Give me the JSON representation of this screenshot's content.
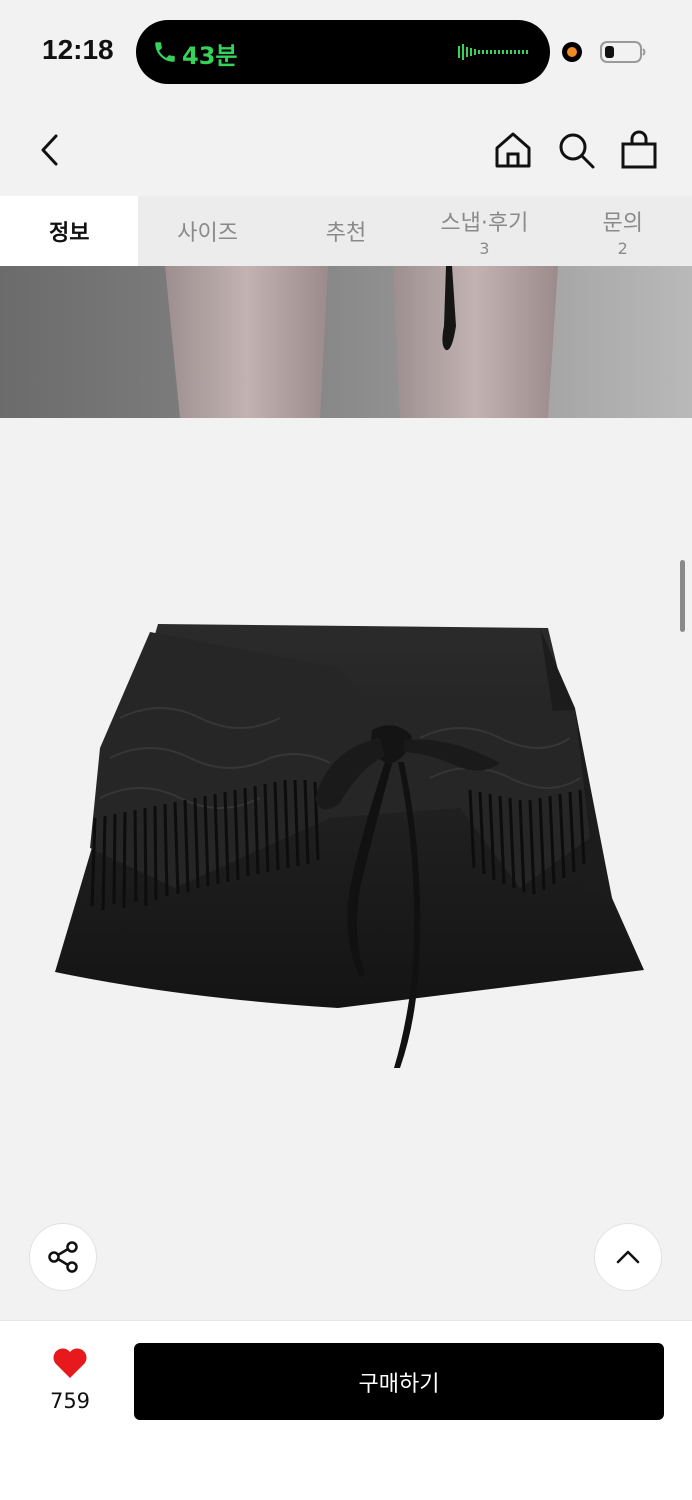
{
  "status_bar": {
    "time": "12:18",
    "call_duration": "43분",
    "accent_green": "#35d35a",
    "recording_color": "#f08a24"
  },
  "header": {
    "icons": [
      "back-icon",
      "home-icon",
      "search-icon",
      "bag-icon"
    ]
  },
  "tabs": [
    {
      "label": "정보",
      "count": "",
      "active": true
    },
    {
      "label": "사이즈",
      "count": ""
    },
    {
      "label": "추천",
      "count": ""
    },
    {
      "label": "스냅·후기",
      "count": "3"
    },
    {
      "label": "문의",
      "count": "2"
    }
  ],
  "floating": {
    "share_icon": "share-icon",
    "top_icon": "chevron-up-icon"
  },
  "bottom_bar": {
    "like_count": "759",
    "like_color": "#e8191c",
    "buy_label": "구매하기"
  }
}
